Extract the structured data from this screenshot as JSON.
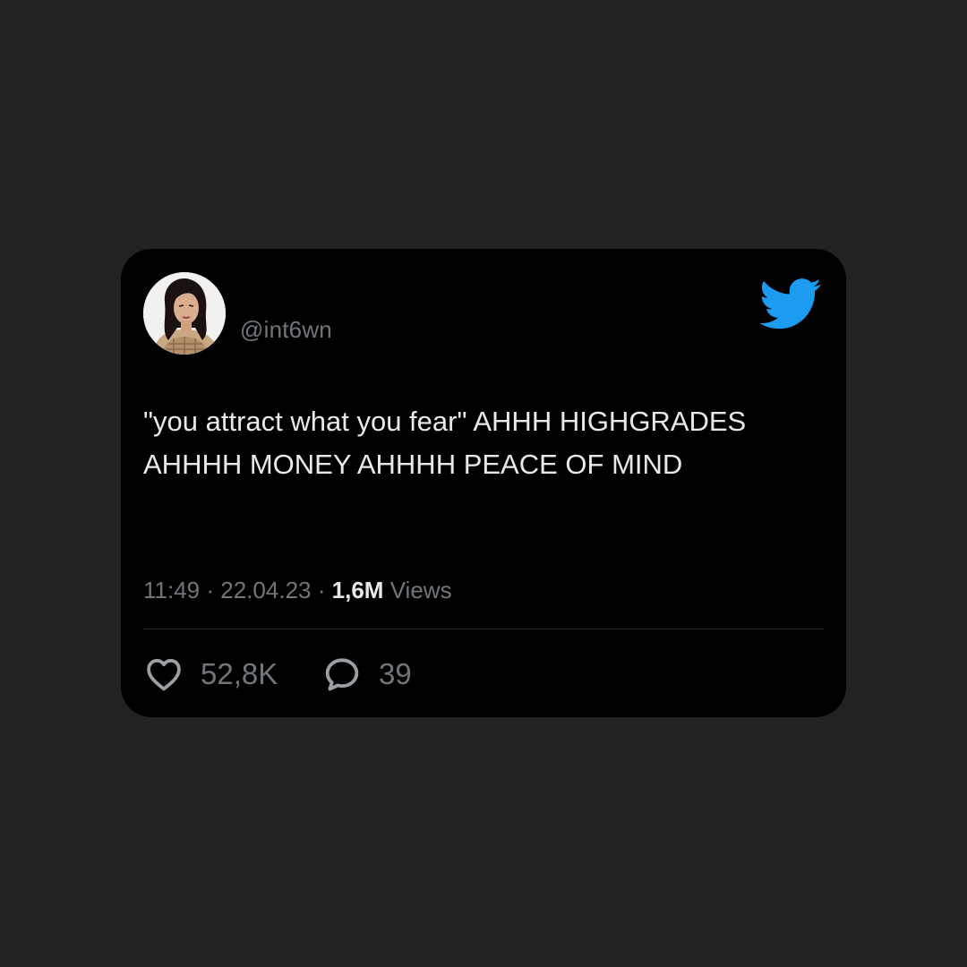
{
  "tweet": {
    "handle": "@int6wn",
    "text": "\"you attract what you fear\" AHHH HIGHGRADES AHHHH MONEY AHHHH PEACE OF MIND",
    "time": "11:49",
    "date": "22.04.23",
    "separator": "·",
    "views_count": "1,6M",
    "views_label": "Views",
    "likes": "52,8K",
    "replies": "39"
  },
  "icons": {
    "brand": "twitter-bird-icon",
    "like": "heart-icon",
    "reply": "speech-bubble-icon"
  },
  "colors": {
    "background": "#222222",
    "card": "#000000",
    "brand_blue": "#1d9bf0",
    "text_primary": "#e7e9ea",
    "text_secondary": "#71767b"
  }
}
